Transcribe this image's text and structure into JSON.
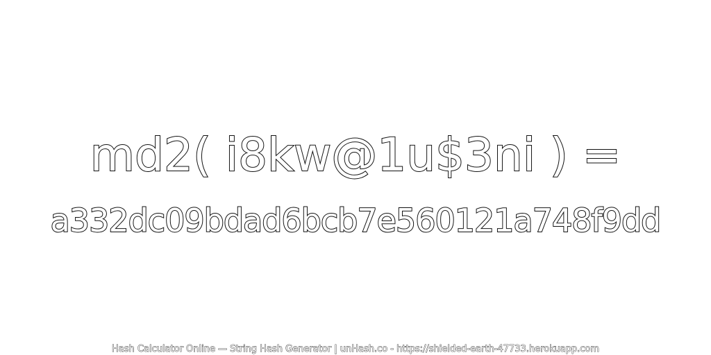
{
  "heading": "md2( i8kw@1u$3ni ) =",
  "hash_value": "a332dc09bdad6bcb7e560121a748f9dd",
  "footer": "Hash Calculator Online — String Hash Generator | unHash.co - https://shielded-earth-47733.herokuapp.com",
  "colors": {
    "background": "#ffffff",
    "text_fill": "#ffffff",
    "text_outline": "#111111"
  }
}
